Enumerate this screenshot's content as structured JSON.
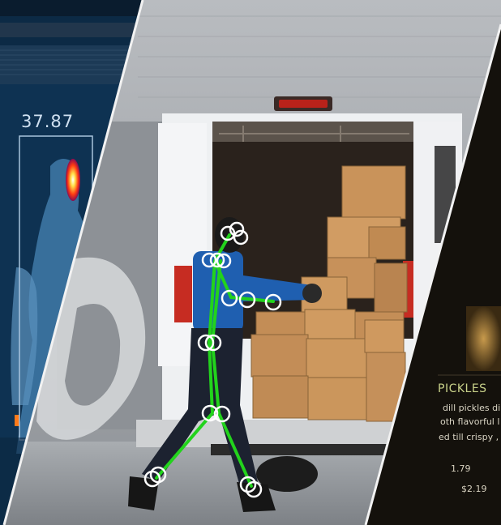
{
  "thermal_panel": {
    "temperature_reading": "37.87"
  },
  "warehouse_panel": {
    "pose_overlay_color": "#22d31c",
    "keypoint_color": "#ffffff"
  },
  "menu_panel": {
    "item_title": "PICKLES",
    "description_lines": [
      "dill pickles di",
      "oth flavorful l",
      "ed till crispy ,"
    ],
    "prices": [
      "1.79",
      "$2.19"
    ]
  },
  "colors": {
    "thermal_bg": "#0c2a45",
    "divider": "#f2f2f2",
    "box_tan": "#c9935a",
    "worker_shirt": "#1f5fb0",
    "menu_bg": "#14110c"
  }
}
